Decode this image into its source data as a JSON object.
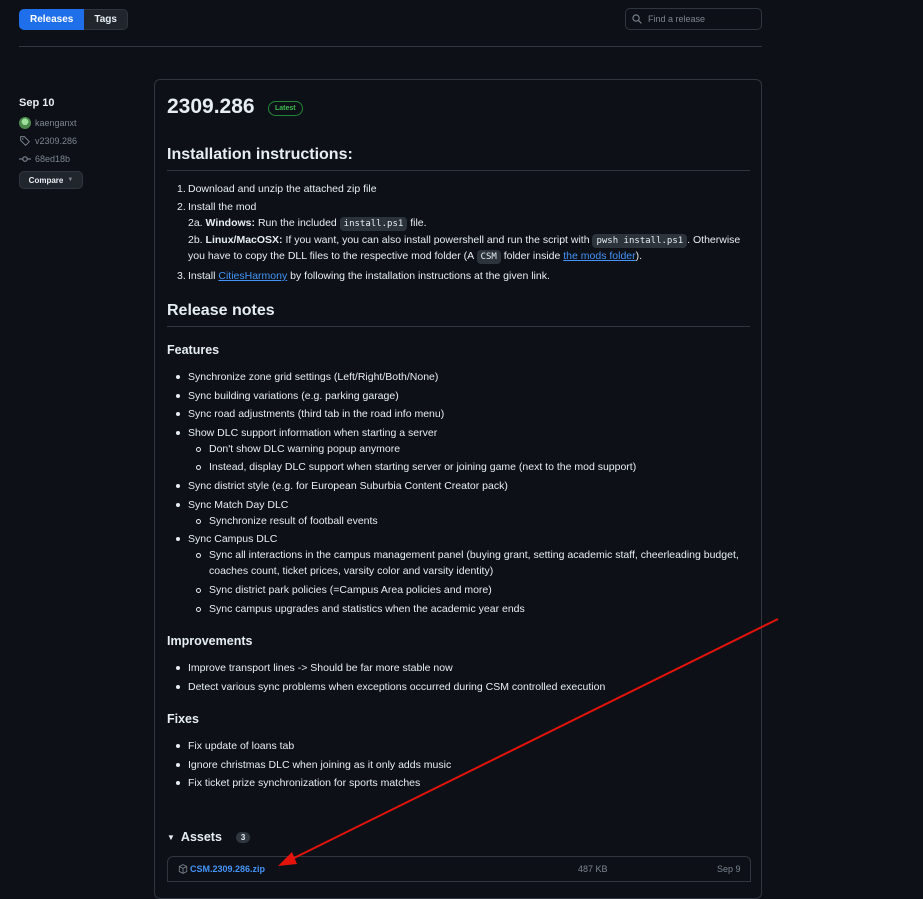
{
  "nav": {
    "tabs": [
      {
        "label": "Releases"
      },
      {
        "label": "Tags"
      }
    ],
    "search_placeholder": "Find a release"
  },
  "meta": {
    "date": "Sep 10",
    "author": "kaenganxt",
    "tag": "v2309.286",
    "commit": "68ed18b",
    "compare_label": "Compare"
  },
  "release": {
    "title": "2309.286",
    "badge": "Latest",
    "install_heading": "Installation instructions:",
    "install_1": "Download and unzip the attached zip file",
    "install_2": "Install the mod",
    "install_2a_prefix": "2a.",
    "install_2a_bold": "Windows:",
    "install_2a_text": "Run the included",
    "install_2a_code": "install.ps1",
    "install_2a_suffix": "file.",
    "install_2b_prefix": "2b.",
    "install_2b_bold": "Linux/MacOSX:",
    "install_2b_text": "If you want, you can also install powershell and run the script with",
    "install_2b_code": "pwsh install.ps1",
    "install_2b_suffix": ". Otherwise",
    "install_2b_line2_a": "you have to copy the DLL files to the respective mod folder (A",
    "install_2b_line2_code": "CSM",
    "install_2b_line2_b": "folder inside",
    "install_2b_link": "the mods folder",
    "install_2b_line2_c": ").",
    "install_3_a": "Install",
    "install_3_link": "CitiesHarmony",
    "install_3_b": "by following the installation instructions at the given link.",
    "notes_heading": "Release notes",
    "features_heading": "Features",
    "features": [
      "Synchronize zone grid settings (Left/Right/Both/None)",
      "Sync building variations (e.g. parking garage)",
      "Sync road adjustments (third tab in the road info menu)",
      "Show DLC support information when starting a server",
      "Don't show DLC warning popup anymore",
      "Instead, display DLC support when starting server or joining game (next to the mod support)",
      "Sync district style (e.g. for European Suburbia Content Creator pack)",
      "Sync Match Day DLC",
      "Synchronize result of football events",
      "Sync Campus DLC",
      "Sync all interactions in the campus management panel (buying grant, setting academic staff, cheerleading budget,",
      "coaches count, ticket prices, varsity color and varsity identity)",
      "Sync district park policies (=Campus Area policies and more)",
      "Sync campus upgrades and statistics when the academic year ends"
    ],
    "improvements_heading": "Improvements",
    "improvements": [
      "Improve transport lines -> Should be far more stable now",
      "Detect various sync problems when exceptions occurred during CSM controlled execution"
    ],
    "fixes_heading": "Fixes",
    "fixes": [
      "Fix update of loans tab",
      "Ignore christmas DLC when joining as it only adds music",
      "Fix ticket prize synchronization for sports matches"
    ]
  },
  "assets": {
    "heading": "Assets",
    "count": "3",
    "file_name": "CSM.2309.286.zip",
    "file_size": "487 KB",
    "file_date": "Sep 9"
  },
  "colors": {
    "background": "#0d1117",
    "accent": "#1f6feb",
    "link": "#4493f8",
    "latest": "#3fb950",
    "arrow": "#e3120b"
  }
}
